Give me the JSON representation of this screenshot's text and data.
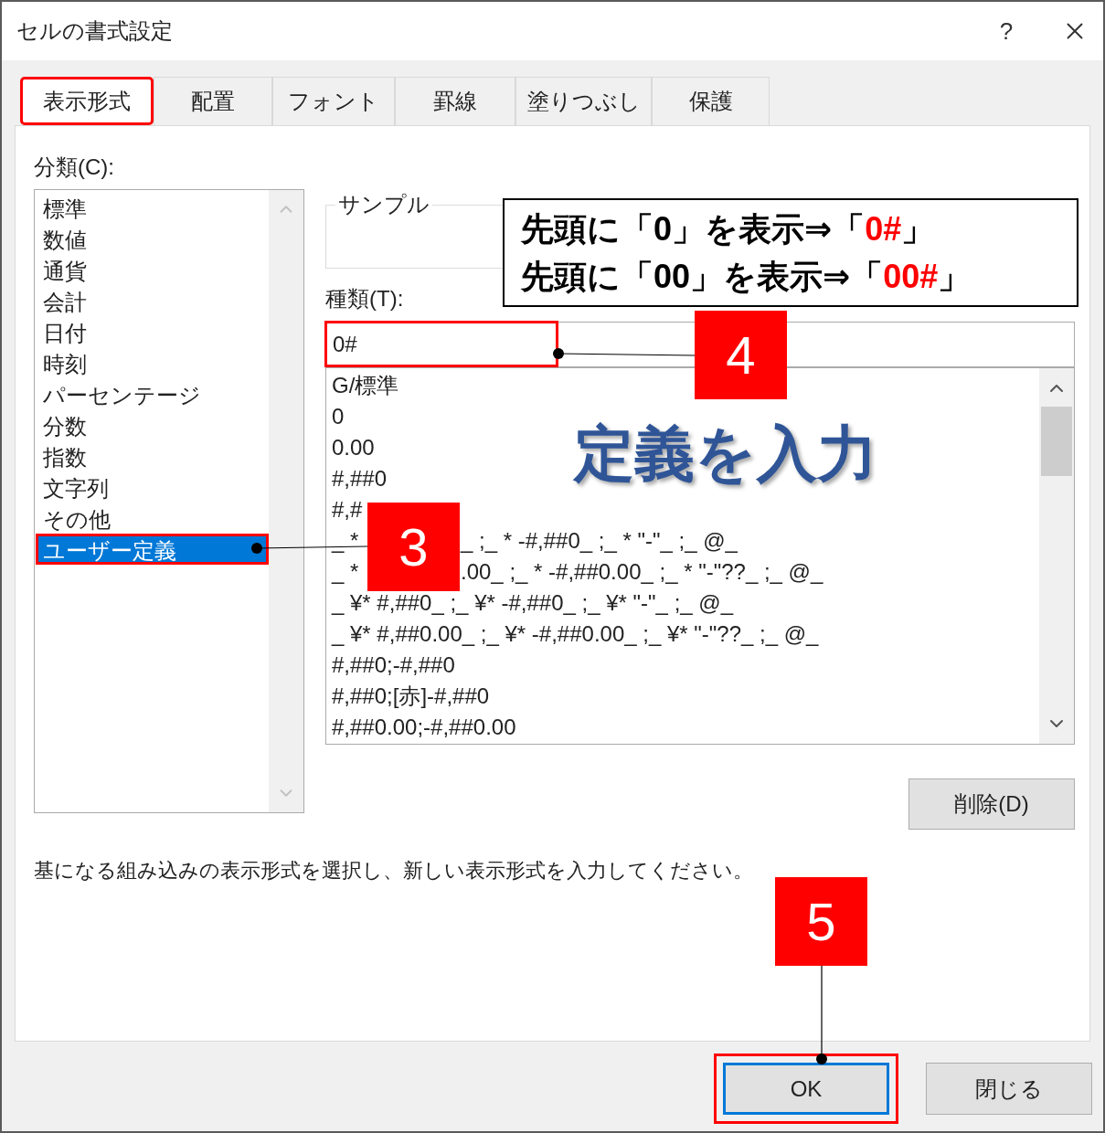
{
  "window": {
    "title": "セルの書式設定",
    "help": "?"
  },
  "tabs": [
    {
      "label": "表示形式",
      "selected": true,
      "highlighted": true
    },
    {
      "label": "配置",
      "selected": false,
      "highlighted": false
    },
    {
      "label": "フォント",
      "selected": false,
      "highlighted": false
    },
    {
      "label": "罫線",
      "selected": false,
      "highlighted": false
    },
    {
      "label": "塗りつぶし",
      "selected": false,
      "highlighted": false
    },
    {
      "label": "保護",
      "selected": false,
      "highlighted": false
    }
  ],
  "category": {
    "label": "分類(C):",
    "items": [
      {
        "label": "標準",
        "selected": false,
        "highlighted": false
      },
      {
        "label": "数値",
        "selected": false,
        "highlighted": false
      },
      {
        "label": "通貨",
        "selected": false,
        "highlighted": false
      },
      {
        "label": "会計",
        "selected": false,
        "highlighted": false
      },
      {
        "label": "日付",
        "selected": false,
        "highlighted": false
      },
      {
        "label": "時刻",
        "selected": false,
        "highlighted": false
      },
      {
        "label": "パーセンテージ",
        "selected": false,
        "highlighted": false
      },
      {
        "label": "分数",
        "selected": false,
        "highlighted": false
      },
      {
        "label": "指数",
        "selected": false,
        "highlighted": false
      },
      {
        "label": "文字列",
        "selected": false,
        "highlighted": false
      },
      {
        "label": "その他",
        "selected": false,
        "highlighted": false
      },
      {
        "label": "ユーザー定義",
        "selected": true,
        "highlighted": true
      }
    ]
  },
  "sample": {
    "legend": "サンプル"
  },
  "type": {
    "label": "種類(T):",
    "value": "0#",
    "highlighted": true
  },
  "formats": [
    {
      "parts": [
        "G/標準"
      ]
    },
    {
      "parts": [
        "0"
      ]
    },
    {
      "parts": [
        "0.00"
      ]
    },
    {
      "parts": [
        "#,##0"
      ]
    },
    {
      "parts": [
        "#,#"
      ]
    },
    {
      "parts": [
        "_ *",
        "_ ;_ * -#,##0_ ;_ * \"-\"_ ;_ @_"
      ]
    },
    {
      "parts": [
        "_ *",
        ".00_ ;_ * -#,##0.00_ ;_ * \"-\"??_ ;_ @_"
      ]
    },
    {
      "parts": [
        "_ ¥* #,##0_ ;_ ¥* -#,##0_ ;_ ¥* \"-\"_ ;_ @_"
      ]
    },
    {
      "parts": [
        "_ ¥* #,##0.00_ ;_ ¥* -#,##0.00_ ;_ ¥* \"-\"??_ ;_ @_"
      ]
    },
    {
      "parts": [
        "#,##0;-#,##0"
      ]
    },
    {
      "parts": [
        "#,##0;[赤]-#,##0"
      ]
    },
    {
      "parts": [
        "#,##0.00;-#,##0.00"
      ]
    }
  ],
  "delete_button": "削除(D)",
  "description": "基になる組み込みの表示形式を選択し、新しい表示形式を入力してください。",
  "buttons": [
    {
      "label": "OK",
      "default": true,
      "highlighted": true
    },
    {
      "label": "閉じる",
      "default": false,
      "highlighted": false
    }
  ],
  "callout": {
    "lines": [
      [
        {
          "text": "先頭に「0」を表示⇒「",
          "emphasis": false
        },
        {
          "text": "0#",
          "emphasis": true
        },
        {
          "text": "」",
          "emphasis": false
        }
      ],
      [
        {
          "text": "先頭に「00」を表示⇒「",
          "emphasis": false
        },
        {
          "text": "00#",
          "emphasis": true
        },
        {
          "text": "」",
          "emphasis": false
        }
      ]
    ]
  },
  "headline": "定義を入力",
  "step_badges": [
    "3",
    "4",
    "5"
  ]
}
